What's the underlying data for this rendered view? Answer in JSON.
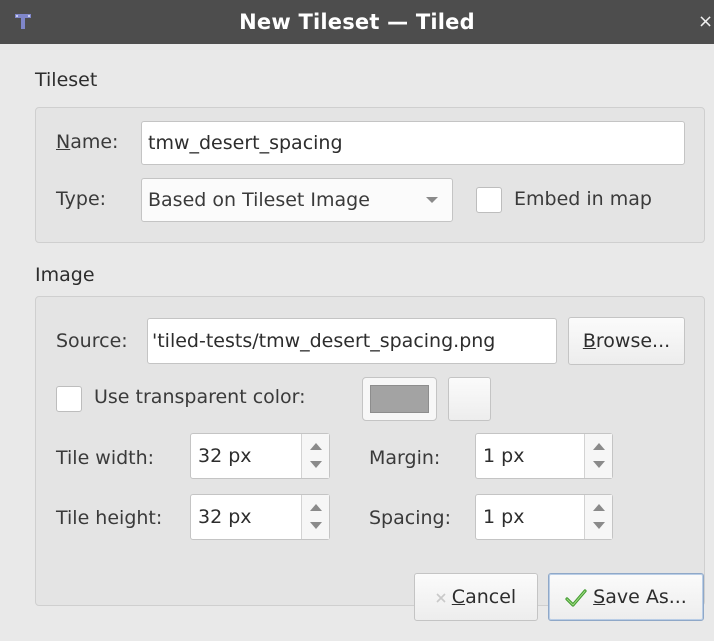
{
  "window": {
    "title": "New Tileset — Tiled",
    "close_glyph": "×"
  },
  "tileset": {
    "section_title": "Tileset",
    "name_label": "ame:",
    "name_mnemonic": "N",
    "name_value": "tmw_desert_spacing",
    "type_label": "Type:",
    "type_selected": "Based on Tileset Image",
    "embed_label": "Embed in map",
    "embed_checked": false
  },
  "image": {
    "section_title": "Image",
    "source_label": "Source:",
    "source_value": "'tiled-tests/tmw_desert_spacing.png",
    "browse_mnemonic": "B",
    "browse_rest": "rowse...",
    "use_transparent_label": "Use transparent color:",
    "use_transparent_checked": false,
    "transparent_color": "#a3a3a3",
    "tile_width_label": "Tile width:",
    "tile_width_value": "32 px",
    "tile_height_label": "Tile height:",
    "tile_height_value": "32 px",
    "margin_label": "Margin:",
    "margin_value": "1 px",
    "spacing_label": "Spacing:",
    "spacing_value": "1 px"
  },
  "buttons": {
    "cancel_mnemonic": "C",
    "cancel_rest": "ancel",
    "save_mnemonic": "S",
    "save_rest": "ave As..."
  },
  "icons": {
    "app": "tiled-app-icon",
    "cancel": "cancel-x-icon",
    "save": "checkmark-icon"
  }
}
